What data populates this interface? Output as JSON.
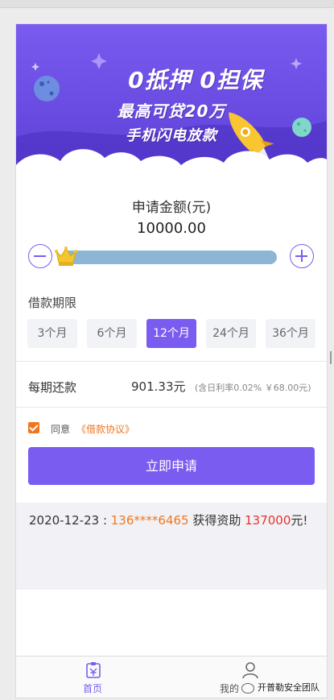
{
  "banner": {
    "line1": "0抵押 0担保",
    "line2": "最高可贷20万",
    "line3": "手机闪电放款",
    "colors": {
      "top": "#7a5bf0",
      "bottom": "#5c3fd6"
    }
  },
  "loan": {
    "amount_label": "申请金额(元)",
    "amount_value": "10000.00",
    "minus_icon": "minus-circle-icon",
    "plus_icon": "plus-circle-icon",
    "slider_fraction": 0
  },
  "term": {
    "label": "借款期限",
    "options": [
      "3个月",
      "6个月",
      "12个月",
      "24个月",
      "36个月"
    ],
    "selected": "12个月"
  },
  "repay": {
    "label": "每期还款",
    "value": "901.33元",
    "note": "(含日利率0.02% ￥68.00元)"
  },
  "agreement": {
    "prefix": "同意",
    "link": "《借款协议》",
    "checked": true
  },
  "apply_button": "立即申请",
  "notice": {
    "date": "2020-12-23 : ",
    "phone": "136****6465",
    "middle": " 获得资助 ",
    "amount": "137000",
    "suffix": "元!"
  },
  "tabs": [
    {
      "label": "首页",
      "icon": "home-icon"
    },
    {
      "label": "我的",
      "icon": "user-icon"
    }
  ],
  "watermark": "开普勒安全团队",
  "accent": "#7b5cf0",
  "orange": "#f0761f",
  "red": "#e8322d"
}
